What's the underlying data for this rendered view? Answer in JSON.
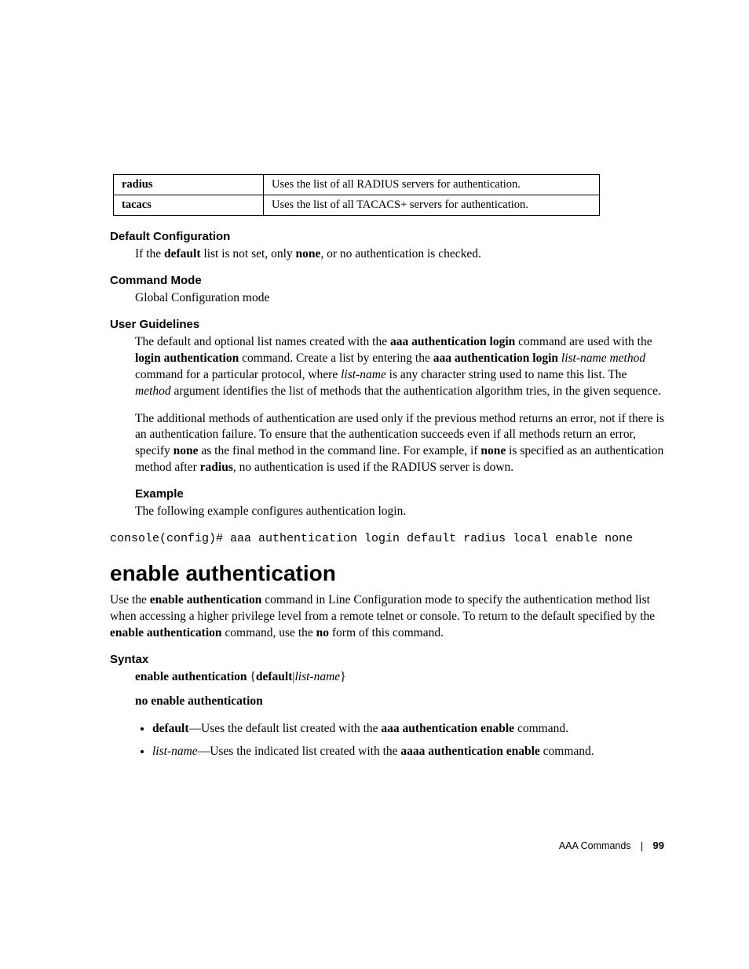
{
  "table": {
    "rows": [
      {
        "key": "radius",
        "desc": "Uses the list of all RADIUS servers for authentication."
      },
      {
        "key": "tacacs",
        "desc": "Uses the list of all TACACS+ servers for authentication."
      }
    ]
  },
  "sections": {
    "default_config": {
      "heading": "Default Configuration",
      "text_pre": "If the ",
      "bold1": "default",
      "text_mid1": " list is not set, only ",
      "bold2": "none",
      "text_post": ", or no authentication is checked."
    },
    "command_mode": {
      "heading": "Command Mode",
      "text": "Global Configuration mode"
    },
    "user_guidelines": {
      "heading": "User Guidelines",
      "p1_a": "The default and optional list names created with the ",
      "p1_b1": "aaa authentication login",
      "p1_b": " command are used with the ",
      "p1_b2": "login authentication",
      "p1_c": " command. Create a list by entering the ",
      "p1_b3": "aaa authentication login",
      "p1_d": " ",
      "p1_i1": "list-name method",
      "p1_e": " command for a particular protocol, where ",
      "p1_i2": "list-name",
      "p1_f": " is any character string used to name this list. The ",
      "p1_i3": "method",
      "p1_g": " argument identifies the list of methods that the authentication algorithm tries, in the given sequence.",
      "p2_a": "The additional methods of authentication are used only if the previous method returns an error, not if there is an authentication failure. To ensure that the authentication succeeds even if all methods return an error, specify ",
      "p2_b1": "none",
      "p2_b": " as the final method in the command line. For example, if ",
      "p2_b2": "none",
      "p2_c": " is specified as an authentication method after ",
      "p2_b3": "radius",
      "p2_d": ", no authentication is used if the RADIUS server is down."
    },
    "example": {
      "heading": "Example",
      "text": "The following example configures authentication login.",
      "code": "console(config)# aaa authentication login default radius local enable none"
    }
  },
  "command": {
    "title": "enable authentication",
    "desc_a": "Use the ",
    "desc_b1": "enable authentication",
    "desc_b": " command in Line Configuration mode to specify the authentication method list when accessing a higher privilege level from a remote telnet or console. To return to the default specified by the ",
    "desc_b2": "enable authentication",
    "desc_c": " command, use the ",
    "desc_b3": "no",
    "desc_d": " form of this command.",
    "syntax_heading": "Syntax",
    "syntax1_b1": "enable authentication",
    "syntax1_mid": " {",
    "syntax1_b2": "default",
    "syntax1_sep": "|",
    "syntax1_i1": "list-name",
    "syntax1_end": "}",
    "syntax2": "no enable authentication",
    "bullet1_b1": "default",
    "bullet1_mid": "—Uses the default list created with the ",
    "bullet1_b2": "aaa authentication enable",
    "bullet1_end": " command.",
    "bullet2_i1": "list-name",
    "bullet2_mid": "—Uses the indicated list created with the ",
    "bullet2_b1": "aaaa authentication enable",
    "bullet2_end": " command."
  },
  "footer": {
    "section": "AAA Commands",
    "page": "99"
  }
}
